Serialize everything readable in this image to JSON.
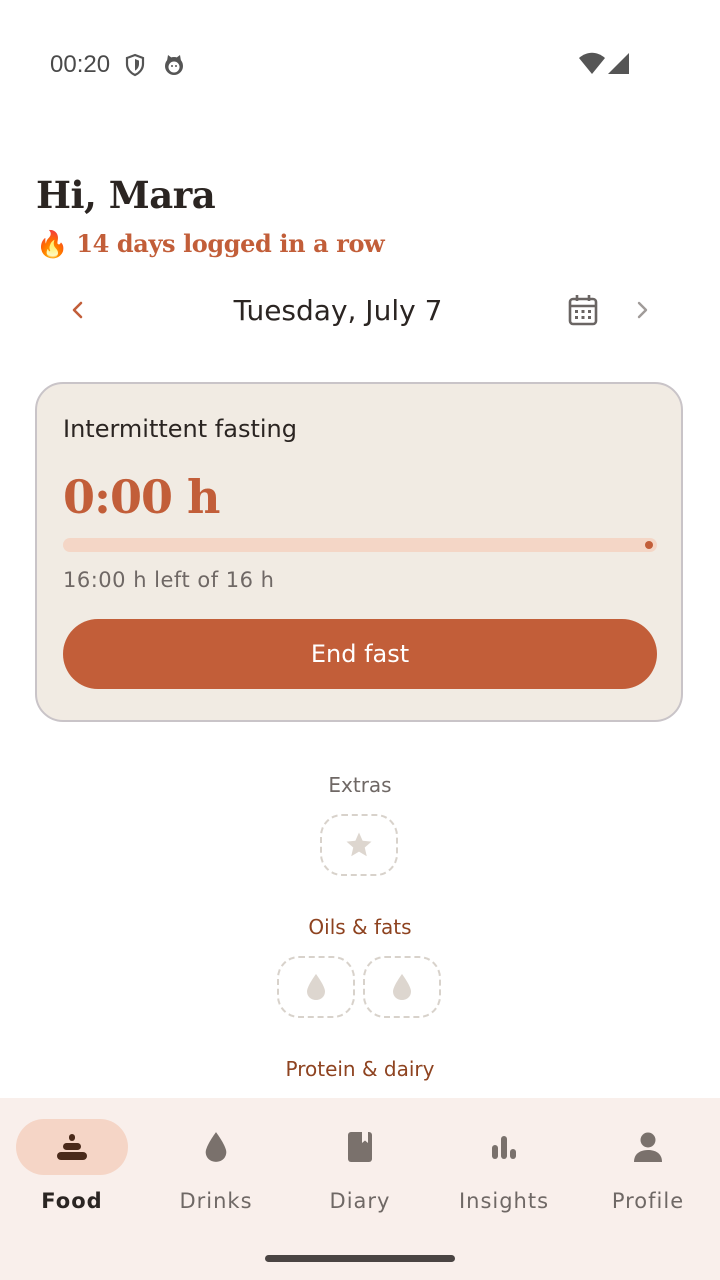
{
  "status_bar": {
    "time": "00:20",
    "icons": [
      "shield-icon",
      "cat-icon",
      "wifi-icon",
      "cellular-icon"
    ]
  },
  "header": {
    "greeting": "Hi, Mara",
    "streak_emoji": "🔥",
    "streak_text": "14 days logged in a row"
  },
  "date_nav": {
    "date_label": "Tuesday, July 7",
    "icons": [
      "chevron-left-icon",
      "calendar-icon",
      "chevron-right-icon"
    ]
  },
  "fasting": {
    "title": "Intermittent fasting",
    "elapsed": "0:00 h",
    "progress": 0,
    "time_left": "16:00 h left of 16 h",
    "end_button_label": "End fast"
  },
  "categories": [
    {
      "label": "Extras",
      "slot_icons": [
        "star-icon"
      ]
    },
    {
      "label": "Oils & fats",
      "slot_icons": [
        "drop-icon",
        "drop-icon"
      ]
    },
    {
      "label": "Protein & dairy",
      "slot_icons": []
    }
  ],
  "bottom_nav": {
    "items": [
      {
        "label": "Food",
        "icon": "food-stack-icon",
        "active": true
      },
      {
        "label": "Drinks",
        "icon": "drop-icon",
        "active": false
      },
      {
        "label": "Diary",
        "icon": "diary-book-icon",
        "active": false
      },
      {
        "label": "Insights",
        "icon": "bar-chart-icon",
        "active": false
      },
      {
        "label": "Profile",
        "icon": "person-icon",
        "active": false
      }
    ]
  },
  "colors": {
    "accent": "#c25e39",
    "card_bg": "#f1ebe3",
    "progress_track": "#f4d6c6",
    "nav_bg": "#f9efeb",
    "nav_active_pill": "#f5d5c6",
    "category_label": "#8e4320"
  }
}
